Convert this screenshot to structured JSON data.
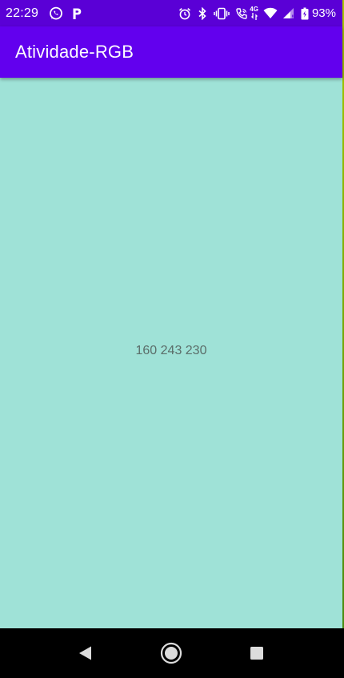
{
  "status_bar": {
    "time": "22:29",
    "left_icons": [
      "whatsapp-icon",
      "parking-icon"
    ],
    "right_icons": [
      "alarm-icon",
      "bluetooth-icon",
      "vibrate-icon",
      "volte-call-icon",
      "4g-data-icon",
      "wifi-icon",
      "cell-signal-icon",
      "battery-icon"
    ],
    "network_label": "4G",
    "battery_percent": "93%",
    "color": "#5a00d6"
  },
  "app_bar": {
    "title": "Atividade-RGB",
    "color": "#6200ee"
  },
  "content": {
    "background_color": "#a0f3e6",
    "rgb_text": "160 243 230"
  },
  "nav_bar": {
    "buttons": [
      "back-icon",
      "home-icon",
      "recents-icon"
    ]
  }
}
